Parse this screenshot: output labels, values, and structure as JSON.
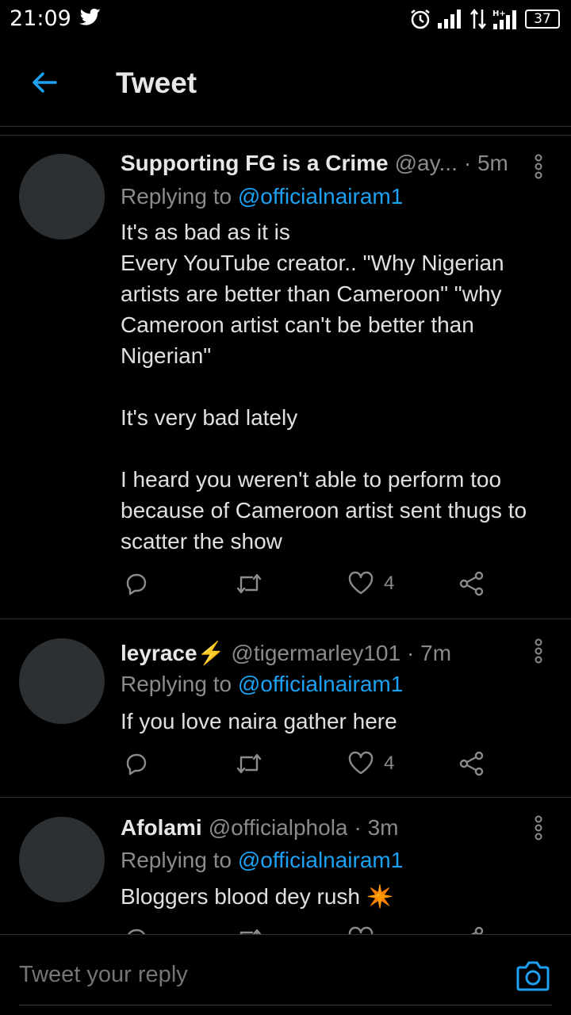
{
  "status_bar": {
    "time": "21:09",
    "battery": "37",
    "network": "H+"
  },
  "header": {
    "title": "Tweet"
  },
  "tweets": [
    {
      "name": "Supporting FG is a Crime",
      "handle": "@ay...",
      "time": "· 5m",
      "replying_prefix": "Replying to",
      "replying_to": "@officialnairam1",
      "text": "It's as bad as it is\nEvery YouTube creator.. \"Why Nigerian artists are better than Cameroon\" \"why Cameroon artist can't be better than Nigerian\"\n\nIt's very bad lately\n\nI heard you weren't able to perform too because of Cameroon artist sent thugs to scatter the show",
      "likes": "4"
    },
    {
      "name": "leyrace⚡",
      "handle": "@tigermarley101",
      "time": "· 7m",
      "replying_prefix": "Replying to",
      "replying_to": "@officialnairam1",
      "text": "If you love naira gather here",
      "likes": "4"
    },
    {
      "name": "Afolami",
      "handle": "@officialphola",
      "time": "· 3m",
      "replying_prefix": "Replying to",
      "replying_to": "@officialnairam1",
      "text": "Bloggers blood dey rush ✴️",
      "likes": ""
    }
  ],
  "reply_bar": {
    "placeholder": "Tweet your reply"
  },
  "colors": {
    "accent": "#1da1f2",
    "background": "#000000",
    "muted": "#8b8b8b"
  }
}
